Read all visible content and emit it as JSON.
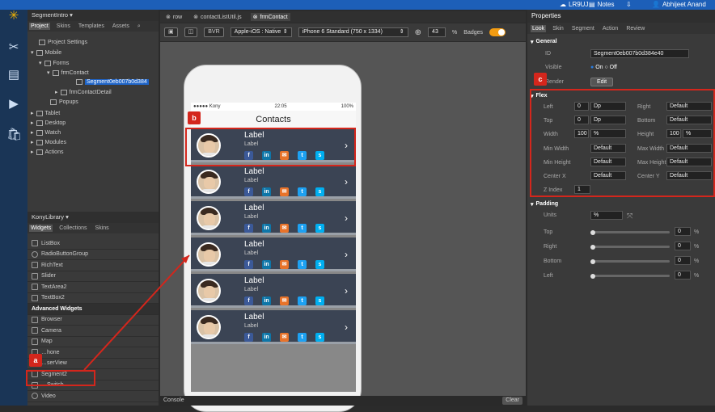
{
  "topbar": {
    "cloud_label": "LR9UJ",
    "notes_label": "Notes",
    "user_label": "Abhijeet Anand"
  },
  "colors": {
    "accent": "#1d5fb8",
    "annotation": "#d4261c",
    "segment_bg": "#3b4454"
  },
  "rail": {
    "icons": [
      "kony-logo-icon",
      "tools-icon",
      "notes-icon",
      "preview-icon",
      "store-icon"
    ]
  },
  "project": {
    "title": "SegmentIntro ▾",
    "tabs": [
      "Project",
      "Skins",
      "Templates",
      "Assets"
    ],
    "tree": {
      "project_settings": "Project Settings",
      "mobile": "Mobile",
      "forms": "Forms",
      "frm_contact": "frmContact",
      "segment": "Segment0eb007b0d384",
      "frm_contact_detail": "frmContactDetail",
      "popups": "Popups",
      "tablet": "Tablet",
      "desktop": "Desktop",
      "watch": "Watch",
      "modules": "Modules",
      "actions": "Actions"
    }
  },
  "library": {
    "title": "KonyLibrary ▾",
    "tabs": [
      "Widgets",
      "Collections",
      "Skins"
    ],
    "items": [
      "ListBox",
      "RadioButtonGroup",
      "RichText",
      "Slider",
      "TextArea2",
      "TextBox2"
    ],
    "advanced_header": "Advanced Widgets",
    "advanced_items": [
      "Browser",
      "Camera",
      "Map",
      "…hone",
      "…serView",
      "Segment2",
      "…Switch",
      "Video"
    ]
  },
  "doctabs": [
    "row",
    "contactListUtil.js",
    "frmContact"
  ],
  "toolbar": {
    "bvr": "BVR",
    "platform": "Apple-iOS : Native",
    "device": "iPhone 6 Standard (750 x 1334)",
    "zoom": "43",
    "zoom_unit": "%",
    "badges": "Badges"
  },
  "phone": {
    "carrier": "●●●●● Kony",
    "time": "22:05",
    "battery": "100%",
    "nav_title": "Contacts",
    "rows": [
      {
        "title": "Label",
        "subtitle": "Label"
      },
      {
        "title": "Label",
        "subtitle": "Label"
      },
      {
        "title": "Label",
        "subtitle": "Label"
      },
      {
        "title": "Label",
        "subtitle": "Label"
      },
      {
        "title": "Label",
        "subtitle": "Label"
      },
      {
        "title": "Label",
        "subtitle": "Label"
      }
    ],
    "social": [
      {
        "label": "f",
        "color": "#3b5998"
      },
      {
        "label": "in",
        "color": "#0e76a8"
      },
      {
        "label": "✉",
        "color": "#e8732a"
      },
      {
        "label": "t",
        "color": "#1da1f2"
      },
      {
        "label": "s",
        "color": "#00aff0"
      }
    ],
    "chevron": "›"
  },
  "console": {
    "label": "Console",
    "clear": "Clear"
  },
  "properties": {
    "title": "Properties",
    "tabs": [
      "Look",
      "Skin",
      "Segment",
      "Action",
      "Review"
    ],
    "general": "General",
    "id_label": "ID",
    "id_value": "Segment0eb007b0d384e40",
    "visible_label": "Visible",
    "on": "On",
    "off": "Off",
    "render_label": "Render",
    "edit": "Edit",
    "flex": "Flex",
    "left": "Left",
    "left_val": "0",
    "left_unit": "Dp",
    "right": "Right",
    "right_val": "Default",
    "top": "Top",
    "top_val": "0",
    "top_unit": "Dp",
    "bottom": "Bottom",
    "bottom_val": "Default",
    "width": "Width",
    "width_val": "100",
    "width_unit": "%",
    "height": "Height",
    "height_val": "100",
    "height_unit": "%",
    "min_width": "Min Width",
    "min_width_val": "Default",
    "max_width": "Max Width",
    "max_width_val": "Default",
    "min_height": "Min Height",
    "min_height_val": "Default",
    "max_height": "Max Height",
    "max_height_val": "Default",
    "center_x": "Center X",
    "center_x_val": "Default",
    "center_y": "Center Y",
    "center_y_val": "Default",
    "z_index": "Z Index",
    "z_index_val": "1",
    "padding": "Padding",
    "units": "Units",
    "units_val": "%",
    "pad_top": "Top",
    "pad_right": "Right",
    "pad_bottom": "Bottom",
    "pad_left": "Left",
    "pad_val": "0",
    "pad_unit": "%"
  },
  "callouts": {
    "a": "a",
    "b": "b",
    "c": "c"
  }
}
